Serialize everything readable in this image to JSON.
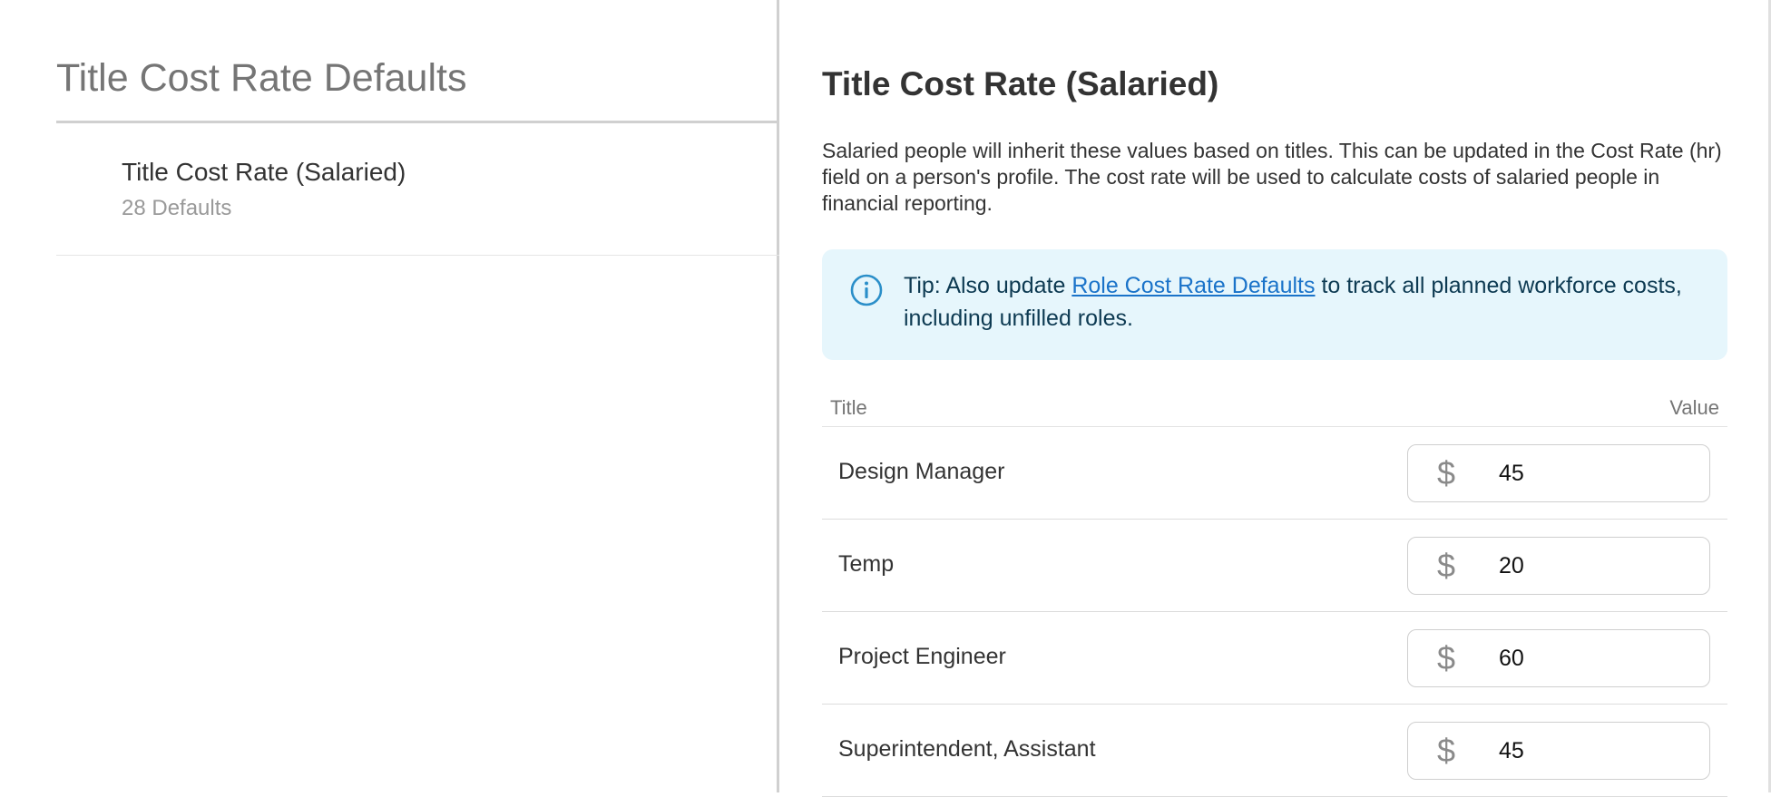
{
  "sidebar": {
    "title": "Title Cost Rate Defaults",
    "items": [
      {
        "label": "Title Cost Rate (Salaried)",
        "subtitle": "28 Defaults"
      }
    ]
  },
  "main": {
    "title": "Title Cost Rate (Salaried)",
    "description": "Salaried people will inherit these values based on titles. This can be updated in the Cost Rate (hr) field on a person's profile. The cost rate will be used to calculate costs of salaried people in financial reporting.",
    "tip": {
      "icon": "info-icon",
      "prefix": "Tip: Also update ",
      "link_text": "Role Cost Rate Defaults",
      "suffix": " to track all planned workforce costs, including unfilled roles."
    },
    "table": {
      "headers": {
        "title": "Title",
        "value": "Value"
      },
      "currency_symbol": "$",
      "rows": [
        {
          "title": "Design Manager",
          "value": "45"
        },
        {
          "title": "Temp",
          "value": "20"
        },
        {
          "title": "Project Engineer",
          "value": "60"
        },
        {
          "title": "Superintendent, Assistant",
          "value": "45"
        }
      ]
    }
  },
  "colors": {
    "tip_background": "#e6f6fc",
    "link": "#1a73c9",
    "info_icon": "#2b8fc9"
  }
}
